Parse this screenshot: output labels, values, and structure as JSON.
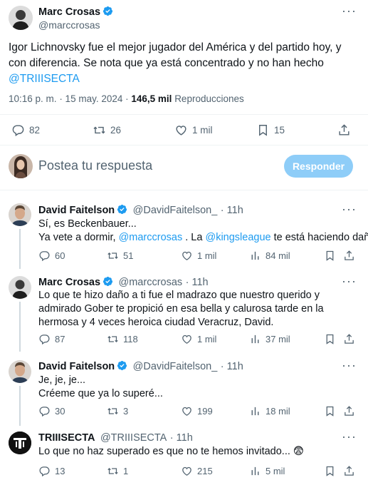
{
  "main_tweet": {
    "author_name": "Marc Crosas",
    "author_handle": "@marccrosas",
    "text_part1": "Igor Lichnovsky fue el mejor jugador del América y del partido hoy, y con diferencia. Se nota que ya está concentrado y no han hecho ",
    "text_mention": "@TRIIISECTA",
    "time": "10:16 p. m.",
    "date": "· 15 may. 2024 ·",
    "views_count": "146,5 mil",
    "views_label": "Reproducciones",
    "replies": "82",
    "retweets": "26",
    "likes": "1 mil",
    "bookmarks": "15"
  },
  "composer": {
    "placeholder": "Postea tu respuesta",
    "button": "Responder"
  },
  "replies": [
    {
      "name": "David Faitelson",
      "handle": "@DavidFaitelson_",
      "time": "· 11h",
      "line1": "Sí, es Beckenbauer...",
      "line2_a": "Ya vete a dormir, ",
      "line2_m1": "@marccrosas",
      "line2_b": " . La ",
      "line2_m2": "@kingsleague",
      "line2_c": " te está haciendo daño...",
      "replies": "60",
      "retweets": "51",
      "likes": "1 mil",
      "views": "84 mil"
    },
    {
      "name": "Marc Crosas",
      "handle": "@marccrosas",
      "time": "· 11h",
      "text": "Lo que te hizo daño a ti fue el madrazo que nuestro querido y admirado Gober te propició en esa bella y calurosa tarde en la hermosa y 4 veces heroica ciudad Veracruz, David.",
      "replies": "87",
      "retweets": "118",
      "likes": "1 mil",
      "views": "37 mil"
    },
    {
      "name": "David Faitelson",
      "handle": "@DavidFaitelson_",
      "time": "· 11h",
      "line1": "Je, je, je...",
      "line2": "Créeme que ya lo superé...",
      "replies": "30",
      "retweets": "3",
      "likes": "199",
      "views": "18 mil"
    },
    {
      "name": "TRIIISECTA",
      "handle": "@TRIIISECTA",
      "time": "· 11h",
      "text": "Lo que no haz superado es que no te hemos invitado... 😨",
      "replies": "13",
      "retweets": "1",
      "likes": "215",
      "views": "5 mil"
    }
  ],
  "colors": {
    "verified": "#1d9bf0",
    "link": "#1d9bf0",
    "secondary": "#536471",
    "button_disabled": "#8ecdf8"
  }
}
